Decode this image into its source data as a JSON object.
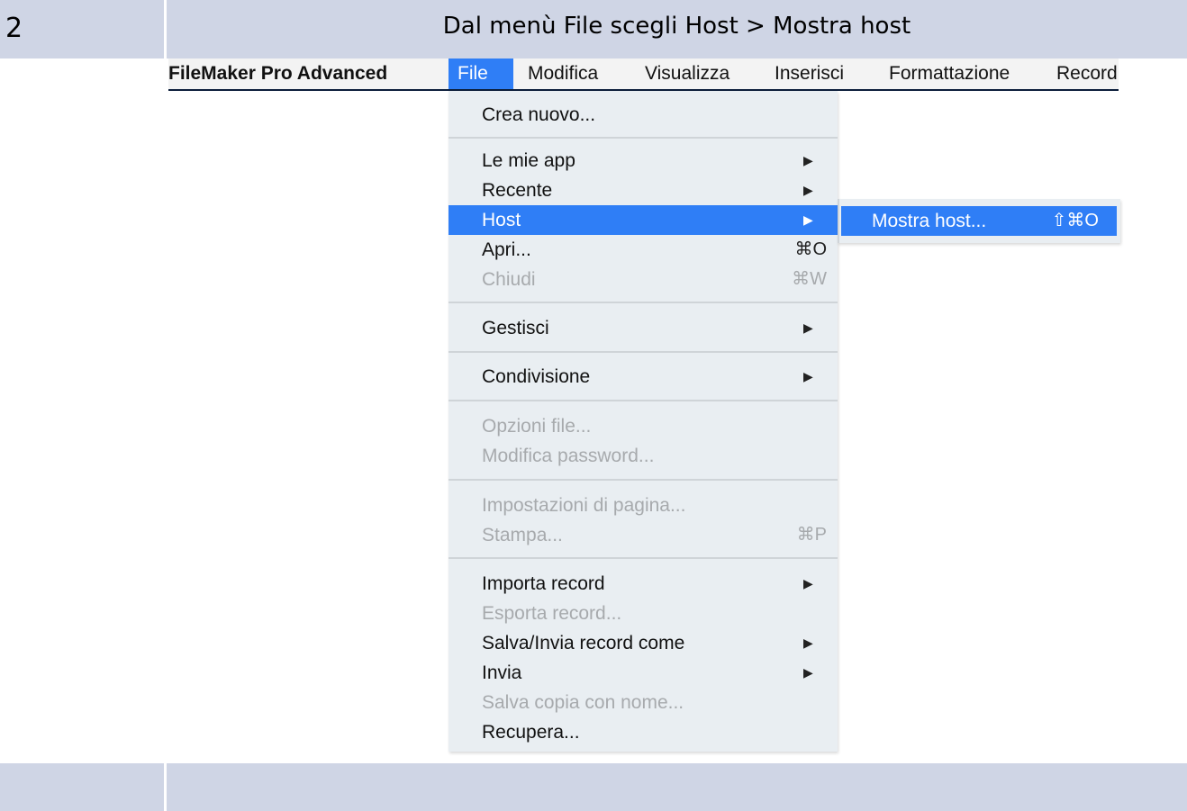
{
  "step": {
    "number": "2",
    "instruction": "Dal menù File scegli Host > Mostra host"
  },
  "menubar": {
    "app_name": "FileMaker Pro Advanced",
    "items": [
      "File",
      "Modifica",
      "Visualizza",
      "Inserisci",
      "Formattazione",
      "Record"
    ]
  },
  "file_menu": {
    "items": [
      {
        "label": "Crea nuovo...",
        "state": "enabled"
      },
      {
        "label": "Le mie app",
        "state": "enabled",
        "submenu": true
      },
      {
        "label": "Recente",
        "state": "enabled",
        "submenu": true
      },
      {
        "label": "Host",
        "state": "highlighted",
        "submenu": true
      },
      {
        "label": "Apri...",
        "state": "enabled",
        "shortcut": "⌘O"
      },
      {
        "label": "Chiudi",
        "state": "disabled",
        "shortcut": "⌘W"
      },
      {
        "label": "Gestisci",
        "state": "enabled",
        "submenu": true
      },
      {
        "label": "Condivisione",
        "state": "enabled",
        "submenu": true
      },
      {
        "label": "Opzioni file...",
        "state": "disabled"
      },
      {
        "label": "Modifica password...",
        "state": "disabled"
      },
      {
        "label": "Impostazioni di pagina...",
        "state": "disabled"
      },
      {
        "label": "Stampa...",
        "state": "disabled",
        "shortcut": "⌘P"
      },
      {
        "label": "Importa record",
        "state": "enabled",
        "submenu": true
      },
      {
        "label": "Esporta record...",
        "state": "disabled"
      },
      {
        "label": "Salva/Invia record come",
        "state": "enabled",
        "submenu": true
      },
      {
        "label": "Invia",
        "state": "enabled",
        "submenu": true
      },
      {
        "label": "Salva copia con nome...",
        "state": "disabled"
      },
      {
        "label": "Recupera...",
        "state": "enabled"
      }
    ]
  },
  "host_submenu": {
    "item_label": "Mostra host...",
    "shortcut": "⇧⌘O"
  },
  "colors": {
    "highlight": "#2f7ef6",
    "table_cell": "#cfd5e5",
    "menu_bg": "#e9eef2",
    "disabled_text": "#a7aaad"
  },
  "icons": {
    "submenu_arrow": "triangle-right-icon"
  }
}
